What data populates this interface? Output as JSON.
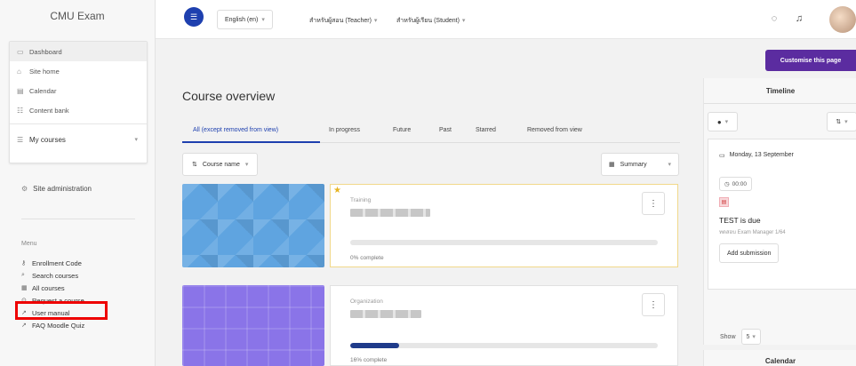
{
  "drawer": {
    "title": "CMU Exam",
    "nav": [
      {
        "label": "Dashboard",
        "icon": "dashboard-icon"
      },
      {
        "label": "Site home",
        "icon": "home-icon"
      },
      {
        "label": "Calendar",
        "icon": "calendar-icon"
      },
      {
        "label": "Content bank",
        "icon": "content-bank-icon"
      }
    ],
    "my_courses": "My courses",
    "site_admin": "Site administration",
    "menu_label": "Menu",
    "menu": [
      {
        "label": "Enrollment Code",
        "icon": "key-icon"
      },
      {
        "label": "Search courses",
        "icon": "search-icon"
      },
      {
        "label": "All courses",
        "icon": "courses-icon"
      },
      {
        "label": "Request a course",
        "icon": "request-icon"
      },
      {
        "label": "User manual",
        "icon": "manual-icon"
      },
      {
        "label": "FAQ Moodle Quiz",
        "icon": "faq-icon"
      }
    ]
  },
  "topbar": {
    "language": "English (en)",
    "teacher": "สำหรับผู้สอน (Teacher)",
    "student": "สำหรับผู้เรียน (Student)"
  },
  "customise_label": "Customise this page",
  "main": {
    "title": "Course overview",
    "tabs": [
      "All (except removed from view)",
      "In progress",
      "Future",
      "Past",
      "Starred",
      "Removed from view"
    ],
    "sort_label": "Course name",
    "view_label": "Summary",
    "courses": [
      {
        "category": "Training",
        "progress": 0,
        "progress_text": "0% complete",
        "starred": true
      },
      {
        "category": "Organization",
        "progress": 16,
        "progress_text": "16% complete",
        "starred": false
      }
    ]
  },
  "timeline": {
    "title": "Timeline",
    "date": "Monday, 13 September",
    "time": "00:00",
    "event": "TEST is due",
    "event_sub": "ทดสอบ Exam Manager 1/64",
    "action": "Add submission",
    "show_label": "Show",
    "show_value": "5"
  },
  "calendar": {
    "title": "Calendar"
  },
  "colors": {
    "primary": "#1e40af",
    "customise": "#5b2ca0",
    "highlight": "#ee0000"
  }
}
